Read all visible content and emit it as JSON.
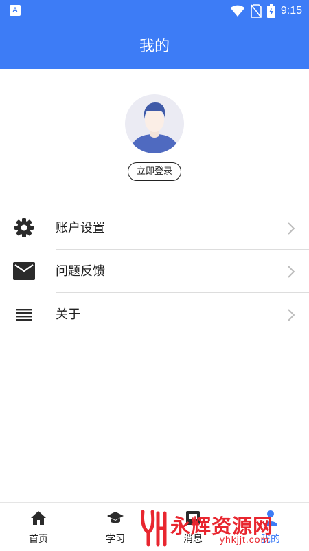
{
  "status_bar": {
    "app_icon_letter": "A",
    "time": "9:15",
    "icons": [
      "wifi-icon",
      "no-sim-icon",
      "battery-charging-icon"
    ]
  },
  "app_bar": {
    "title": "我的"
  },
  "profile": {
    "avatar_icon": "user-avatar-icon",
    "login_label": "立即登录"
  },
  "menu": {
    "items": [
      {
        "label": "账户设置",
        "icon": "gear-icon"
      },
      {
        "label": "问题反馈",
        "icon": "mail-icon"
      },
      {
        "label": "关于",
        "icon": "list-icon"
      }
    ]
  },
  "bottom_nav": {
    "items": [
      {
        "label": "首页",
        "icon": "home-icon",
        "active": false
      },
      {
        "label": "学习",
        "icon": "graduation-cap-icon",
        "active": false
      },
      {
        "label": "消息",
        "icon": "message-icon",
        "active": false
      },
      {
        "label": "我的",
        "icon": "person-icon",
        "active": true
      }
    ]
  },
  "watermark": {
    "text": "永辉资源网",
    "url": "yhkjjt.com"
  },
  "colors": {
    "primary": "#3d7cf6",
    "watermark": "#e8262f",
    "avatar_bg": "#ebebf3",
    "avatar_shirt": "#4f6ac0"
  }
}
